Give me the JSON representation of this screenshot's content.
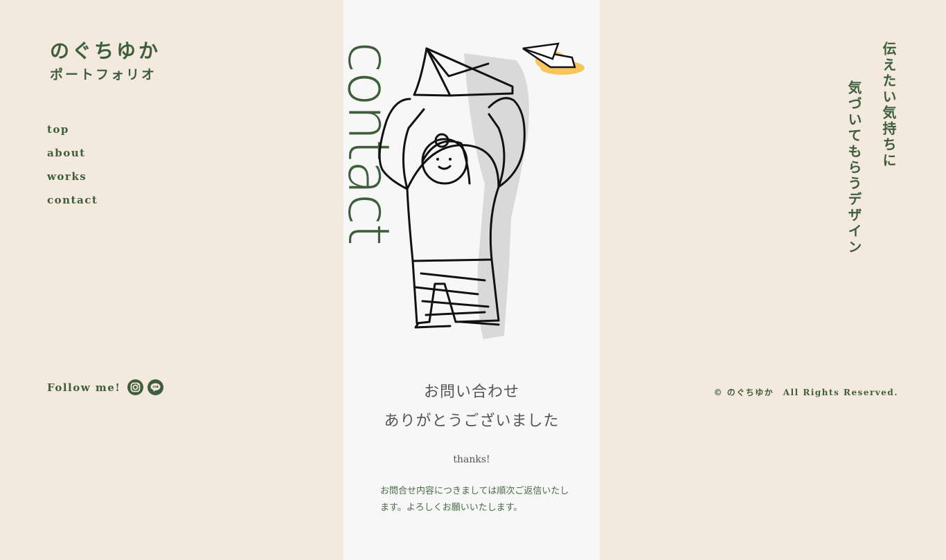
{
  "logo": {
    "title": "のぐちゆか",
    "subtitle": "ポートフォリオ"
  },
  "nav": {
    "items": [
      "top",
      "about",
      "works",
      "contact"
    ]
  },
  "follow": {
    "label": "Follow me!",
    "icons": [
      "instagram-icon",
      "line-icon"
    ]
  },
  "page": {
    "heading": "contact",
    "thanks_line1": "お問い合わせ",
    "thanks_line2": "ありがとうございました",
    "thanks_en": "thanks!",
    "thanks_body": "お問合せ内容につきましては順次ご返信いたします。よろしくお願いいたします。"
  },
  "tagline": {
    "line1": "伝えたい気持ちに",
    "line2": "気づいてもらうデザイン"
  },
  "footer": {
    "copyright": "© のぐちゆか　All Rights Reserved."
  },
  "colors": {
    "background": "#f4e9de",
    "panel": "#f7f7f7",
    "accent": "#3e5e3b",
    "highlight": "#f6c65b"
  }
}
